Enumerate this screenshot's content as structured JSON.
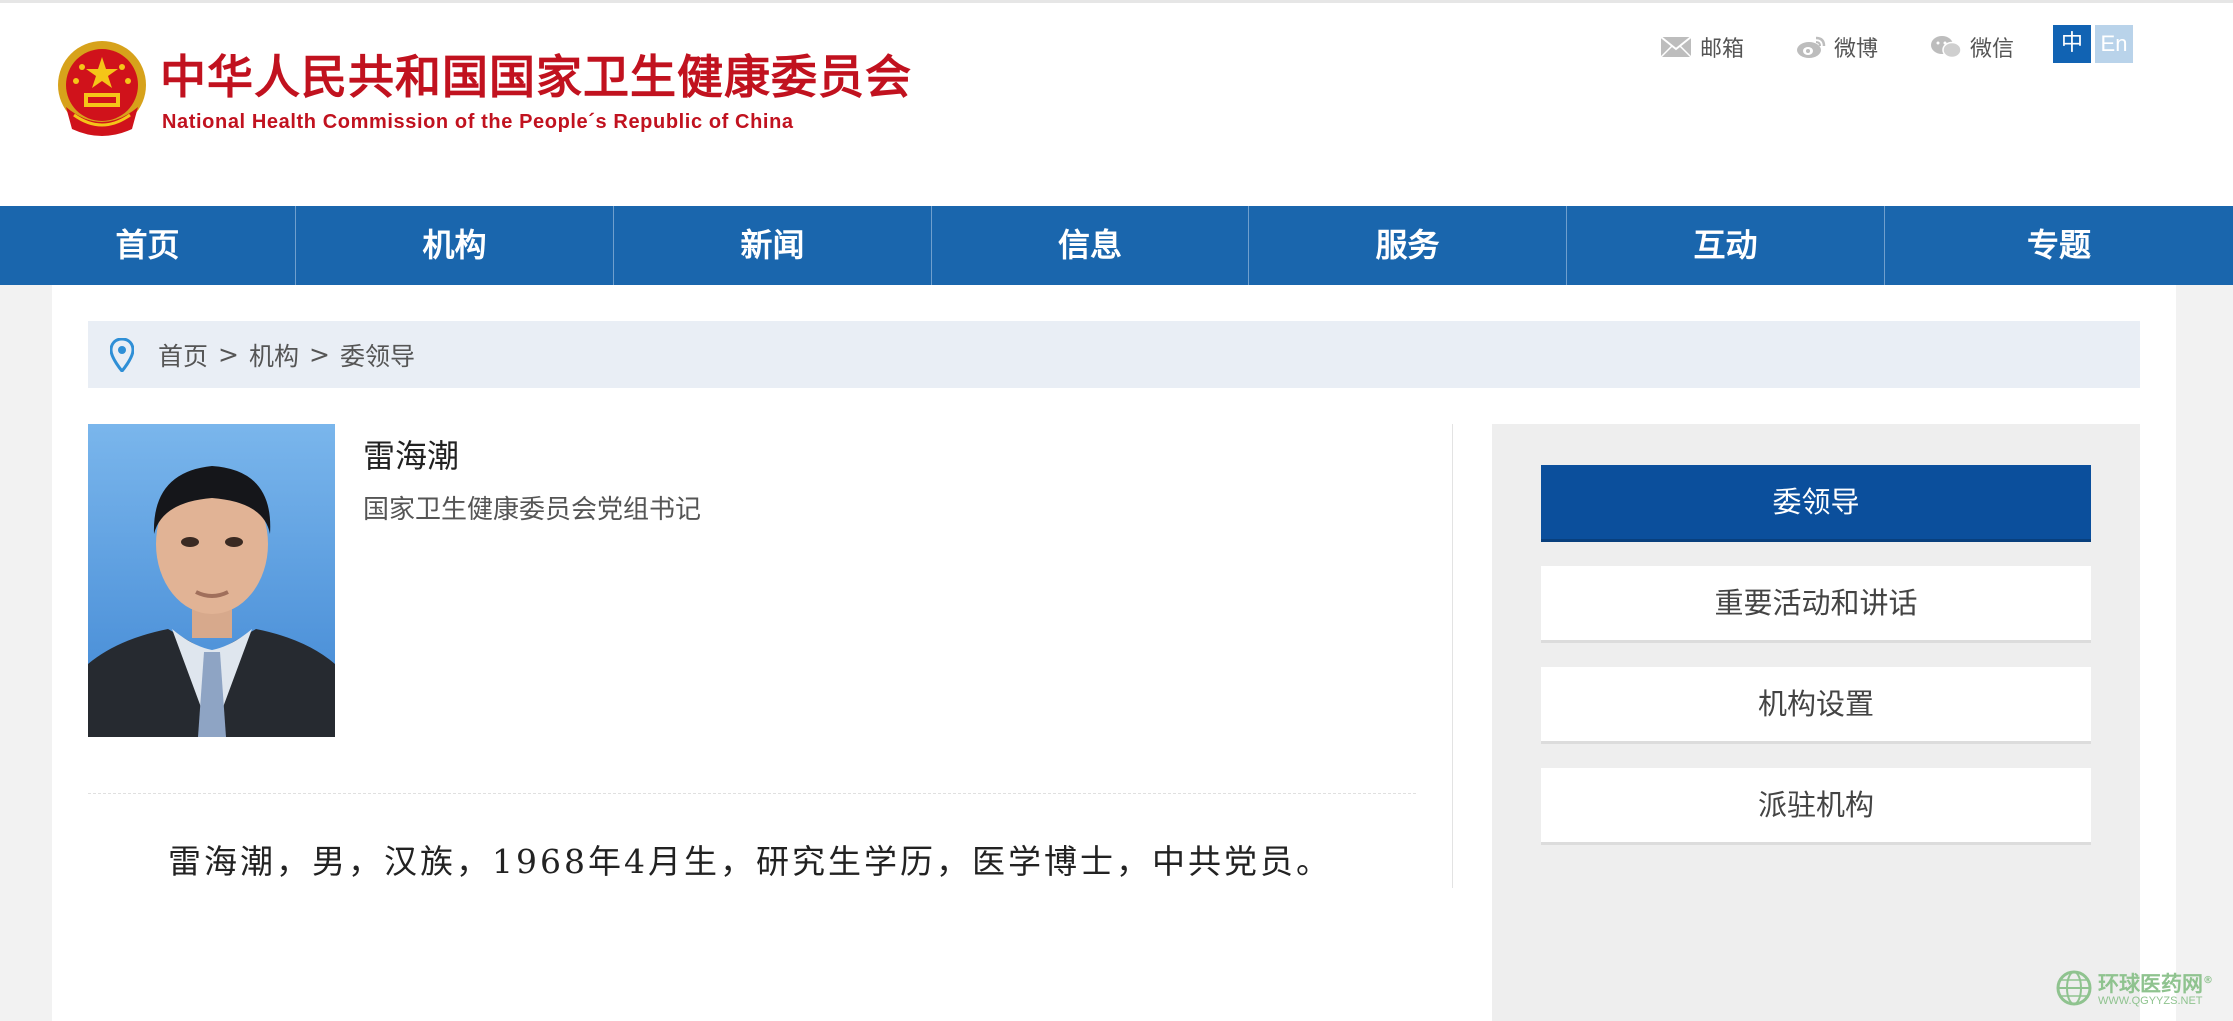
{
  "header": {
    "title_cn": "中华人民共和国国家卫生健康委员会",
    "title_en": "National Health Commission of the People´s Republic of China",
    "links": [
      {
        "label": "邮箱",
        "icon": "mail-icon"
      },
      {
        "label": "微博",
        "icon": "weibo-icon"
      },
      {
        "label": "微信",
        "icon": "wechat-icon"
      }
    ],
    "lang": {
      "zh": "中",
      "en": "En"
    }
  },
  "nav": {
    "items": [
      "首页",
      "机构",
      "新闻",
      "信息",
      "服务",
      "互动",
      "专题"
    ]
  },
  "breadcrumb": {
    "items": [
      "首页",
      "机构",
      "委领导"
    ],
    "separator": ">"
  },
  "profile": {
    "name": "雷海潮",
    "title": "国家卫生健康委员会党组书记",
    "bio": "雷海潮，男，汉族，1968年4月生，研究生学历，医学博士，中共党员。"
  },
  "sidebar": {
    "items": [
      {
        "label": "委领导",
        "active": true
      },
      {
        "label": "重要活动和讲话",
        "active": false
      },
      {
        "label": "机构设置",
        "active": false
      },
      {
        "label": "派驻机构",
        "active": false
      }
    ]
  },
  "watermark": {
    "cn": "环球医药网",
    "en": "WWW.QGYYZS.NET",
    "mark": "®"
  },
  "colors": {
    "brand_red": "#c1121f",
    "nav_blue": "#1a66ad",
    "active_blue": "#0b4f9c"
  }
}
